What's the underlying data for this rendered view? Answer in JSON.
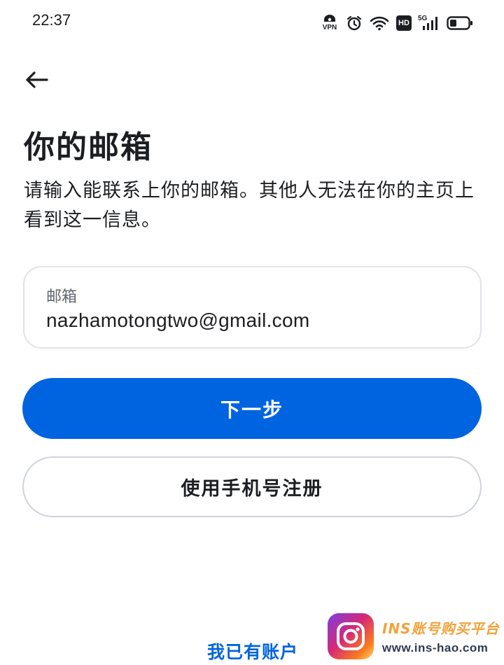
{
  "status_bar": {
    "time": "22:37",
    "vpn_label": "VPN",
    "hd_label": "HD",
    "network_label": "5G"
  },
  "title": "你的邮箱",
  "subtitle": "请输入能联系上你的邮箱。其他人无法在你的主页上看到这一信息。",
  "email_field": {
    "label": "邮箱",
    "value": "nazhamotongtwo@gmail.com"
  },
  "buttons": {
    "next": "下一步",
    "use_phone": "使用手机号注册"
  },
  "links": {
    "have_account": "我已有账户"
  },
  "watermark": {
    "title": "INS账号购买平台",
    "url": "www.ins-hao.com"
  },
  "colors": {
    "primary": "#0064e0",
    "text": "#1c1e21",
    "muted": "#5f6670",
    "border": "#dfe3e8"
  },
  "icons": {
    "back": "arrow-left-icon",
    "vpn": "vpn-icon",
    "alarm": "alarm-clock-icon",
    "wifi": "wifi-icon",
    "hd": "hd-icon",
    "signal": "signal-icon",
    "battery": "battery-icon"
  }
}
